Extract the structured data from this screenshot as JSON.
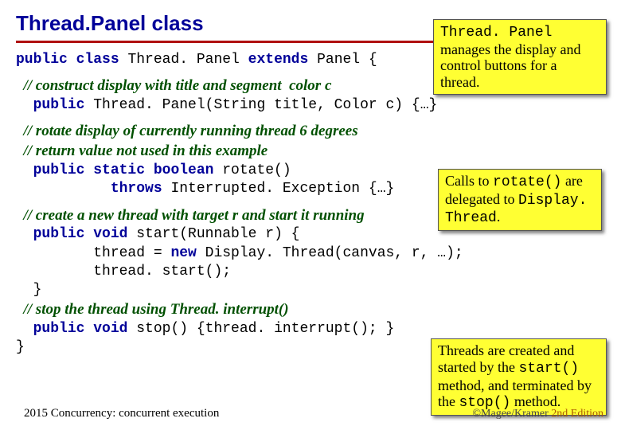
{
  "title": "Thread.Panel class",
  "code_lines": [
    {
      "type": "code",
      "tokens": [
        {
          "t": "public class ",
          "k": true
        },
        {
          "t": "Thread. Panel "
        },
        {
          "t": "extends ",
          "k": true
        },
        {
          "t": "Panel {"
        }
      ]
    },
    {
      "type": "blank"
    },
    {
      "type": "comment",
      "text": "  // construct display with title and segment  color c"
    },
    {
      "type": "code",
      "tokens": [
        {
          "t": "  "
        },
        {
          "t": "public ",
          "k": true
        },
        {
          "t": "Thread. Panel(String title, Color c) {…}"
        }
      ]
    },
    {
      "type": "blank"
    },
    {
      "type": "comment",
      "text": "  // rotate display of currently running thread 6 degrees"
    },
    {
      "type": "comment",
      "text": "  // return value not used in this example"
    },
    {
      "type": "code",
      "tokens": [
        {
          "t": "  "
        },
        {
          "t": "public static boolean ",
          "k": true
        },
        {
          "t": "rotate()"
        }
      ]
    },
    {
      "type": "code",
      "tokens": [
        {
          "t": "           "
        },
        {
          "t": "throws ",
          "k": true
        },
        {
          "t": "Interrupted. Exception {…}"
        }
      ]
    },
    {
      "type": "blank"
    },
    {
      "type": "comment",
      "text": "  // create a new thread with target r and start it running"
    },
    {
      "type": "code",
      "tokens": [
        {
          "t": "  "
        },
        {
          "t": "public void ",
          "k": true
        },
        {
          "t": "start(Runnable r) {"
        }
      ]
    },
    {
      "type": "code",
      "tokens": [
        {
          "t": "         thread = "
        },
        {
          "t": "new ",
          "k": true
        },
        {
          "t": "Display. Thread(canvas, r, …);"
        }
      ]
    },
    {
      "type": "code",
      "tokens": [
        {
          "t": "         thread. start();"
        }
      ]
    },
    {
      "type": "code",
      "tokens": [
        {
          "t": "  }"
        }
      ]
    },
    {
      "type": "comment",
      "text": "  // stop the thread using Thread. interrupt()"
    },
    {
      "type": "code",
      "tokens": [
        {
          "t": "  "
        },
        {
          "t": "public void ",
          "k": true
        },
        {
          "t": "stop() {thread. interrupt(); }"
        }
      ]
    },
    {
      "type": "code",
      "tokens": [
        {
          "t": "}"
        }
      ]
    }
  ],
  "notes": {
    "n1": {
      "prefix": "",
      "mono_a": "Thread. Panel",
      "text_a": "manages the display and control buttons for a thread."
    },
    "n2": {
      "text_a": "Calls to ",
      "mono_a": "rotate()",
      "text_b": " are delegated to ",
      "mono_b": "Display. Thread",
      "text_c": "."
    },
    "n3": {
      "text_a": "Threads are created and started by the ",
      "mono_a": "start()",
      "text_b": " method, and terminated by the ",
      "mono_b": "stop()",
      "text_c": " method."
    }
  },
  "footer_left": "2015  Concurrency: concurrent execution",
  "footer_right_a": "©Magee/Kramer ",
  "footer_right_b": "2nd Edition"
}
